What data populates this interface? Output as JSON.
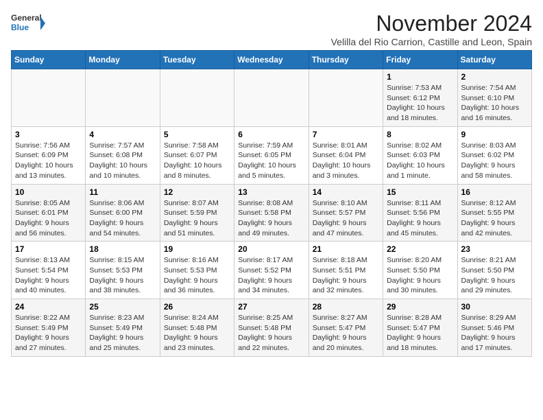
{
  "logo": {
    "line1": "General",
    "line2": "Blue"
  },
  "title": "November 2024",
  "subtitle": "Velilla del Rio Carrion, Castille and Leon, Spain",
  "header": {
    "days": [
      "Sunday",
      "Monday",
      "Tuesday",
      "Wednesday",
      "Thursday",
      "Friday",
      "Saturday"
    ]
  },
  "weeks": [
    {
      "cells": [
        {
          "empty": true
        },
        {
          "empty": true
        },
        {
          "empty": true
        },
        {
          "empty": true
        },
        {
          "empty": true
        },
        {
          "day": "1",
          "sunrise": "Sunrise: 7:53 AM",
          "sunset": "Sunset: 6:12 PM",
          "daylight": "Daylight: 10 hours and 18 minutes."
        },
        {
          "day": "2",
          "sunrise": "Sunrise: 7:54 AM",
          "sunset": "Sunset: 6:10 PM",
          "daylight": "Daylight: 10 hours and 16 minutes."
        }
      ]
    },
    {
      "cells": [
        {
          "day": "3",
          "sunrise": "Sunrise: 7:56 AM",
          "sunset": "Sunset: 6:09 PM",
          "daylight": "Daylight: 10 hours and 13 minutes."
        },
        {
          "day": "4",
          "sunrise": "Sunrise: 7:57 AM",
          "sunset": "Sunset: 6:08 PM",
          "daylight": "Daylight: 10 hours and 10 minutes."
        },
        {
          "day": "5",
          "sunrise": "Sunrise: 7:58 AM",
          "sunset": "Sunset: 6:07 PM",
          "daylight": "Daylight: 10 hours and 8 minutes."
        },
        {
          "day": "6",
          "sunrise": "Sunrise: 7:59 AM",
          "sunset": "Sunset: 6:05 PM",
          "daylight": "Daylight: 10 hours and 5 minutes."
        },
        {
          "day": "7",
          "sunrise": "Sunrise: 8:01 AM",
          "sunset": "Sunset: 6:04 PM",
          "daylight": "Daylight: 10 hours and 3 minutes."
        },
        {
          "day": "8",
          "sunrise": "Sunrise: 8:02 AM",
          "sunset": "Sunset: 6:03 PM",
          "daylight": "Daylight: 10 hours and 1 minute."
        },
        {
          "day": "9",
          "sunrise": "Sunrise: 8:03 AM",
          "sunset": "Sunset: 6:02 PM",
          "daylight": "Daylight: 9 hours and 58 minutes."
        }
      ]
    },
    {
      "cells": [
        {
          "day": "10",
          "sunrise": "Sunrise: 8:05 AM",
          "sunset": "Sunset: 6:01 PM",
          "daylight": "Daylight: 9 hours and 56 minutes."
        },
        {
          "day": "11",
          "sunrise": "Sunrise: 8:06 AM",
          "sunset": "Sunset: 6:00 PM",
          "daylight": "Daylight: 9 hours and 54 minutes."
        },
        {
          "day": "12",
          "sunrise": "Sunrise: 8:07 AM",
          "sunset": "Sunset: 5:59 PM",
          "daylight": "Daylight: 9 hours and 51 minutes."
        },
        {
          "day": "13",
          "sunrise": "Sunrise: 8:08 AM",
          "sunset": "Sunset: 5:58 PM",
          "daylight": "Daylight: 9 hours and 49 minutes."
        },
        {
          "day": "14",
          "sunrise": "Sunrise: 8:10 AM",
          "sunset": "Sunset: 5:57 PM",
          "daylight": "Daylight: 9 hours and 47 minutes."
        },
        {
          "day": "15",
          "sunrise": "Sunrise: 8:11 AM",
          "sunset": "Sunset: 5:56 PM",
          "daylight": "Daylight: 9 hours and 45 minutes."
        },
        {
          "day": "16",
          "sunrise": "Sunrise: 8:12 AM",
          "sunset": "Sunset: 5:55 PM",
          "daylight": "Daylight: 9 hours and 42 minutes."
        }
      ]
    },
    {
      "cells": [
        {
          "day": "17",
          "sunrise": "Sunrise: 8:13 AM",
          "sunset": "Sunset: 5:54 PM",
          "daylight": "Daylight: 9 hours and 40 minutes."
        },
        {
          "day": "18",
          "sunrise": "Sunrise: 8:15 AM",
          "sunset": "Sunset: 5:53 PM",
          "daylight": "Daylight: 9 hours and 38 minutes."
        },
        {
          "day": "19",
          "sunrise": "Sunrise: 8:16 AM",
          "sunset": "Sunset: 5:53 PM",
          "daylight": "Daylight: 9 hours and 36 minutes."
        },
        {
          "day": "20",
          "sunrise": "Sunrise: 8:17 AM",
          "sunset": "Sunset: 5:52 PM",
          "daylight": "Daylight: 9 hours and 34 minutes."
        },
        {
          "day": "21",
          "sunrise": "Sunrise: 8:18 AM",
          "sunset": "Sunset: 5:51 PM",
          "daylight": "Daylight: 9 hours and 32 minutes."
        },
        {
          "day": "22",
          "sunrise": "Sunrise: 8:20 AM",
          "sunset": "Sunset: 5:50 PM",
          "daylight": "Daylight: 9 hours and 30 minutes."
        },
        {
          "day": "23",
          "sunrise": "Sunrise: 8:21 AM",
          "sunset": "Sunset: 5:50 PM",
          "daylight": "Daylight: 9 hours and 29 minutes."
        }
      ]
    },
    {
      "cells": [
        {
          "day": "24",
          "sunrise": "Sunrise: 8:22 AM",
          "sunset": "Sunset: 5:49 PM",
          "daylight": "Daylight: 9 hours and 27 minutes."
        },
        {
          "day": "25",
          "sunrise": "Sunrise: 8:23 AM",
          "sunset": "Sunset: 5:49 PM",
          "daylight": "Daylight: 9 hours and 25 minutes."
        },
        {
          "day": "26",
          "sunrise": "Sunrise: 8:24 AM",
          "sunset": "Sunset: 5:48 PM",
          "daylight": "Daylight: 9 hours and 23 minutes."
        },
        {
          "day": "27",
          "sunrise": "Sunrise: 8:25 AM",
          "sunset": "Sunset: 5:48 PM",
          "daylight": "Daylight: 9 hours and 22 minutes."
        },
        {
          "day": "28",
          "sunrise": "Sunrise: 8:27 AM",
          "sunset": "Sunset: 5:47 PM",
          "daylight": "Daylight: 9 hours and 20 minutes."
        },
        {
          "day": "29",
          "sunrise": "Sunrise: 8:28 AM",
          "sunset": "Sunset: 5:47 PM",
          "daylight": "Daylight: 9 hours and 18 minutes."
        },
        {
          "day": "30",
          "sunrise": "Sunrise: 8:29 AM",
          "sunset": "Sunset: 5:46 PM",
          "daylight": "Daylight: 9 hours and 17 minutes."
        }
      ]
    }
  ]
}
